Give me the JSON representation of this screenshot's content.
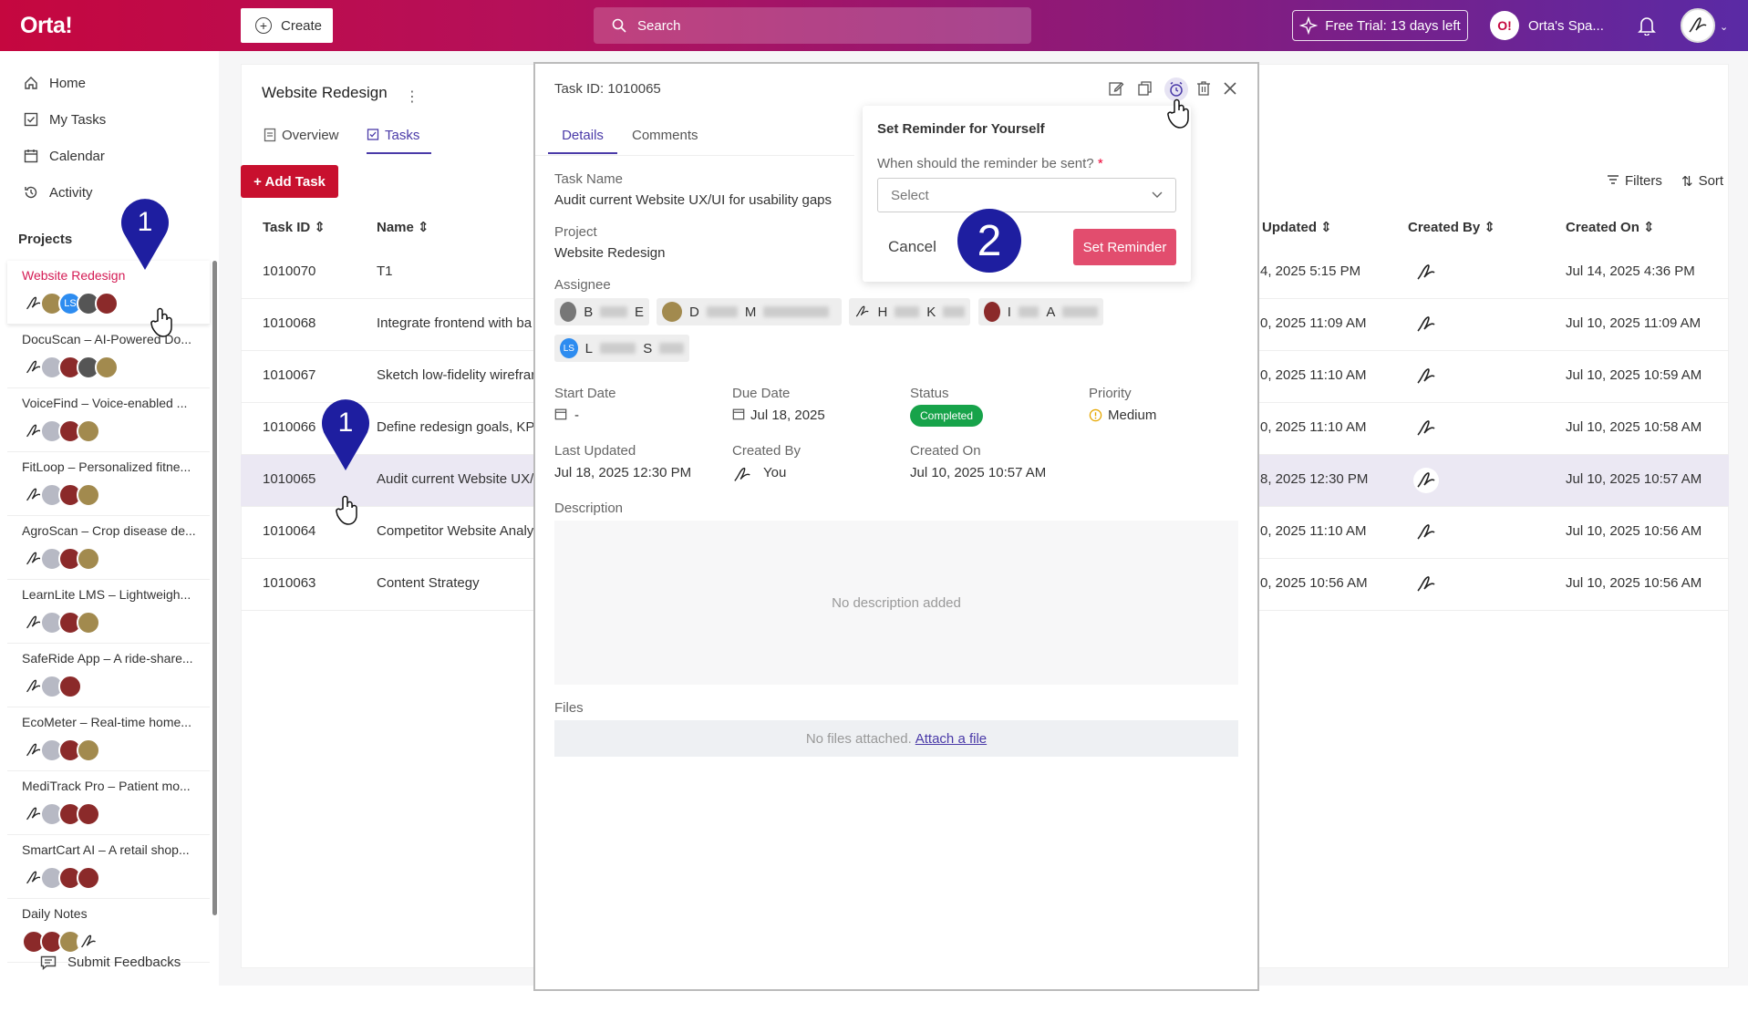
{
  "topbar": {
    "logo": "Orta!",
    "create_label": "Create",
    "search_placeholder": "Search",
    "trial_label": "Free Trial: 13 days left",
    "workspace_logo": "O!",
    "workspace_name": "Orta's Spa..."
  },
  "sidebar": {
    "nav": [
      {
        "label": "Home",
        "icon": "home-icon"
      },
      {
        "label": "My Tasks",
        "icon": "checkbox-icon"
      },
      {
        "label": "Calendar",
        "icon": "calendar-icon"
      },
      {
        "label": "Activity",
        "icon": "history-icon"
      }
    ],
    "projects_heading": "Projects",
    "projects": [
      {
        "name": "Website Redesign",
        "active": true
      },
      {
        "name": "DocuScan – AI-Powered Do..."
      },
      {
        "name": "VoiceFind – Voice-enabled ..."
      },
      {
        "name": "FitLoop – Personalized fitne..."
      },
      {
        "name": "AgroScan – Crop disease de..."
      },
      {
        "name": "LearnLite LMS – Lightweigh..."
      },
      {
        "name": "SafeRide App – A ride-share..."
      },
      {
        "name": "EcoMeter – Real-time home..."
      },
      {
        "name": "MediTrack Pro – Patient mo..."
      },
      {
        "name": "SmartCart AI – A retail shop..."
      },
      {
        "name": "Daily Notes"
      }
    ],
    "avatar_initials": "LS",
    "feedback_label": "Submit Feedbacks"
  },
  "project": {
    "title": "Website Redesign",
    "menu": "⋮",
    "tabs": [
      "Overview",
      "Tasks"
    ],
    "add_task": "+ Add Task",
    "filters": "Filters",
    "sort": "Sort"
  },
  "table": {
    "headers": [
      "Task ID",
      "Name",
      "Updated",
      "Created By",
      "Created On"
    ],
    "rows": [
      {
        "id": "1010070",
        "name": "T1",
        "updated": "4, 2025 5:15 PM",
        "created_on": "Jul 14, 2025 4:36 PM"
      },
      {
        "id": "1010068",
        "name": "Integrate frontend with ba",
        "updated": "0, 2025 11:09 AM",
        "created_on": "Jul 10, 2025 11:09 AM"
      },
      {
        "id": "1010067",
        "name": "Sketch low-fidelity wirefrar",
        "updated": "0, 2025 11:10 AM",
        "created_on": "Jul 10, 2025 10:59 AM"
      },
      {
        "id": "1010066",
        "name": "Define redesign goals, KPIs",
        "updated": "0, 2025 11:10 AM",
        "created_on": "Jul 10, 2025 10:58 AM"
      },
      {
        "id": "1010065",
        "name": "Audit current Website UX/U",
        "updated": "8, 2025 12:30 PM",
        "created_on": "Jul 10, 2025 10:57 AM",
        "selected": true
      },
      {
        "id": "1010064",
        "name": "Competitor Website Analys",
        "updated": "0, 2025 11:10 AM",
        "created_on": "Jul 10, 2025 10:56 AM"
      },
      {
        "id": "1010063",
        "name": "Content Strategy",
        "updated": "0, 2025 10:56 AM",
        "created_on": "Jul 10, 2025 10:56 AM"
      }
    ]
  },
  "panel": {
    "task_id_label": "Task ID:",
    "task_id": "1010065",
    "tabs": [
      "Details",
      "Comments"
    ],
    "task_name_label": "Task Name",
    "task_name": "Audit current Website UX/UI for usability gaps",
    "project_label": "Project",
    "project": "Website Redesign",
    "assignee_label": "Assignee",
    "assignees": [
      {
        "first": "B",
        "last": "E"
      },
      {
        "first": "D",
        "last": "M"
      },
      {
        "first": "H",
        "last": "K"
      },
      {
        "first": "I",
        "last": "A"
      },
      {
        "first": "L",
        "last": "S",
        "initials": "LS"
      }
    ],
    "start_date_label": "Start Date",
    "start_date": "-",
    "due_date_label": "Due Date",
    "due_date": "Jul 18, 2025",
    "status_label": "Status",
    "status": "Completed",
    "priority_label": "Priority",
    "priority": "Medium",
    "last_updated_label": "Last Updated",
    "last_updated": "Jul 18, 2025 12:30 PM",
    "created_by_label": "Created By",
    "created_by": "You",
    "created_on_label": "Created On",
    "created_on": "Jul 10, 2025 10:57 AM",
    "description_label": "Description",
    "description_empty": "No description added",
    "files_label": "Files",
    "files_empty": "No files attached.",
    "attach_link": "Attach a file"
  },
  "reminder": {
    "title": "Set Reminder for Yourself",
    "question": "When should the reminder be sent?",
    "required_mark": "*",
    "select_placeholder": "Select",
    "cancel": "Cancel",
    "submit": "Set Reminder"
  },
  "annotations": {
    "step1": "1",
    "step2": "2"
  },
  "colors": {
    "brand_red": "#c8102e",
    "accent_purple": "#4a3aa8",
    "status_green": "#17a34a",
    "reminder_button": "#e24d6e",
    "step_marker": "#1e1ea0"
  }
}
